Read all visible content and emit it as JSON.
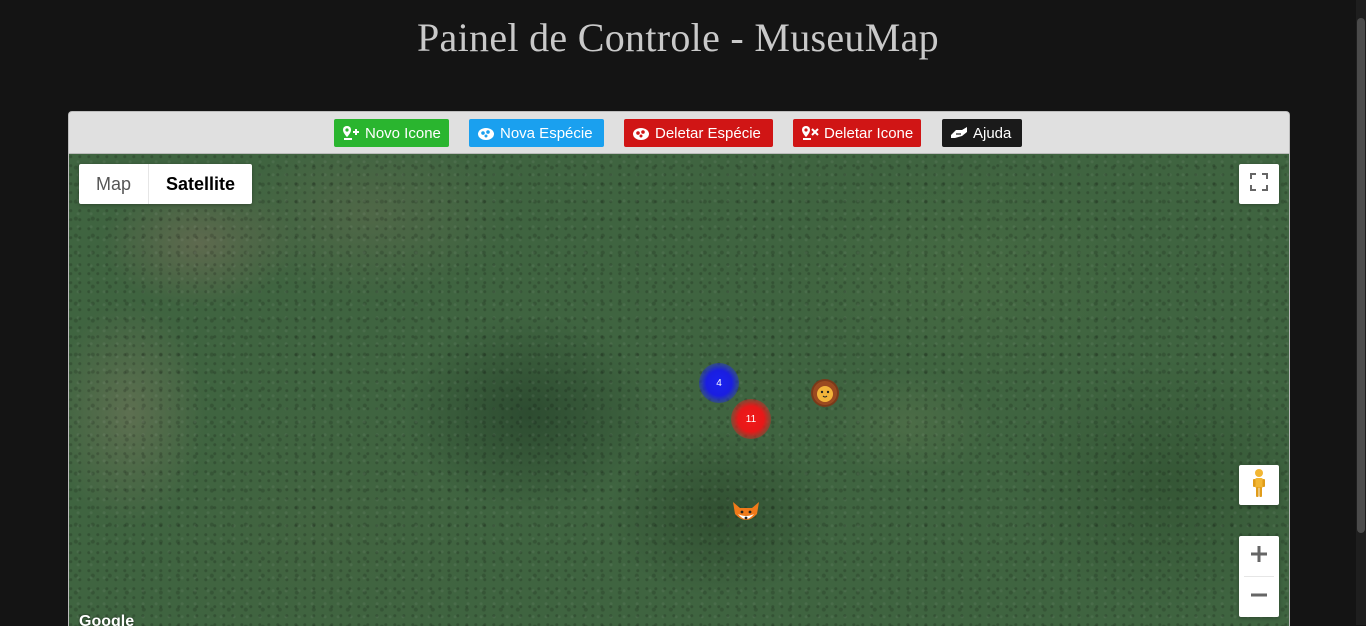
{
  "page": {
    "title": "Painel de Controle - MuseuMap"
  },
  "toolbar": {
    "buttons": [
      {
        "label": "Novo Icone",
        "color": "#2ab52f",
        "icon": "map-marker-add-icon"
      },
      {
        "label": "Nova Espécie",
        "color": "#1aa0ef",
        "icon": "paw-add-icon"
      },
      {
        "label": "Deletar Espécie",
        "color": "#d01515",
        "icon": "paw-delete-icon"
      },
      {
        "label": "Deletar Icone",
        "color": "#d01515",
        "icon": "map-marker-delete-icon"
      },
      {
        "label": "Ajuda",
        "color": "#1a1a1a",
        "icon": "help-hands-icon"
      }
    ]
  },
  "map": {
    "type_control": {
      "options": [
        "Map",
        "Satellite"
      ],
      "selected": "Satellite"
    },
    "clusters": [
      {
        "count": "4",
        "color": "#1a22f0"
      },
      {
        "count": "11",
        "color": "#e81818"
      }
    ],
    "markers": [
      {
        "icon": "lion-icon"
      },
      {
        "icon": "fox-icon"
      }
    ],
    "attribution": "Google",
    "controls": [
      "fullscreen-icon",
      "pegman-icon",
      "zoom-in-icon",
      "zoom-out-icon"
    ]
  }
}
